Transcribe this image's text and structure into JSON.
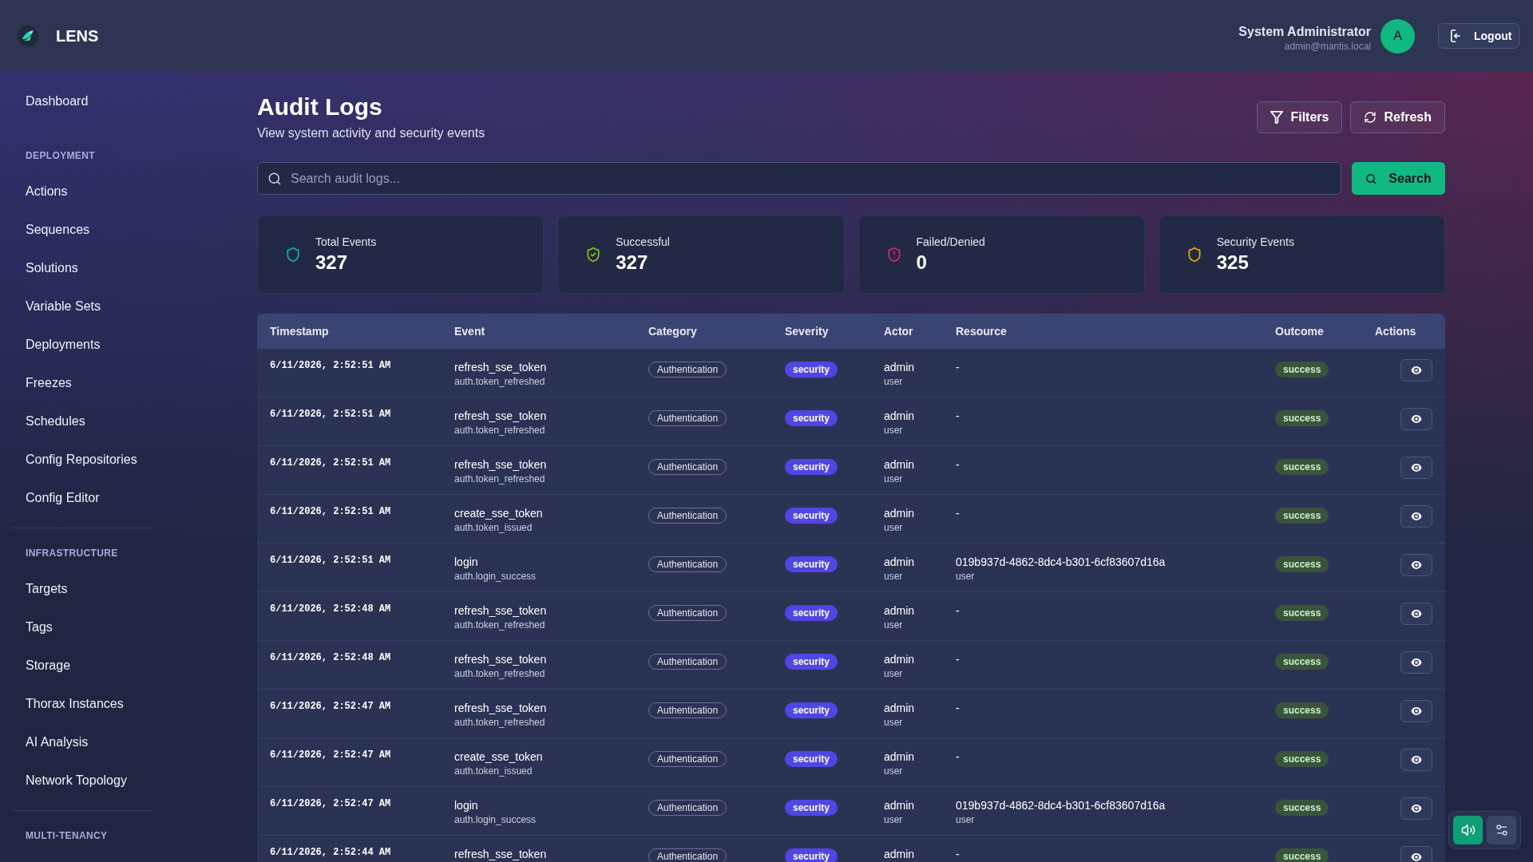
{
  "header": {
    "brand": "LENS",
    "user_name": "System Administrator",
    "user_email": "admin@mantis.local",
    "avatar_initial": "A",
    "logout_label": "Logout"
  },
  "sidebar": {
    "items": [
      {
        "label": "Dashboard",
        "selected": false
      }
    ],
    "sections": [
      {
        "title": "DEPLOYMENT",
        "items": [
          {
            "label": "Actions",
            "selected": false
          },
          {
            "label": "Sequences",
            "selected": false
          },
          {
            "label": "Solutions",
            "selected": false
          },
          {
            "label": "Variable Sets",
            "selected": false
          },
          {
            "label": "Deployments",
            "selected": false
          },
          {
            "label": "Freezes",
            "selected": false
          },
          {
            "label": "Schedules",
            "selected": false
          },
          {
            "label": "Config Repositories",
            "selected": false
          },
          {
            "label": "Config Editor",
            "selected": false
          }
        ]
      },
      {
        "title": "INFRASTRUCTURE",
        "items": [
          {
            "label": "Targets",
            "selected": false
          },
          {
            "label": "Tags",
            "selected": false
          },
          {
            "label": "Storage",
            "selected": false
          },
          {
            "label": "Thorax Instances",
            "selected": false
          },
          {
            "label": "AI Analysis",
            "selected": false
          },
          {
            "label": "Network Topology",
            "selected": false
          }
        ]
      },
      {
        "title": "MULTI-TENANCY"
      }
    ]
  },
  "page": {
    "title": "Audit Logs",
    "subtitle": "View system activity and security events",
    "actions": [
      {
        "label": "Filters"
      },
      {
        "label": "Refresh"
      }
    ]
  },
  "search": {
    "placeholder": "Search audit logs...",
    "button_label": "Search"
  },
  "stats": [
    {
      "label": "Total Events",
      "value": "327",
      "color": "#14b8a6"
    },
    {
      "label": "Successful",
      "value": "327",
      "color": "#84cc16"
    },
    {
      "label": "Failed/Denied",
      "value": "0",
      "color": "#db2777"
    },
    {
      "label": "Security Events",
      "value": "325",
      "color": "#eab308"
    }
  ],
  "table": {
    "columns": [
      "Timestamp",
      "Event",
      "Category",
      "Severity",
      "Actor",
      "Resource",
      "Outcome",
      "Actions"
    ],
    "rows": [
      {
        "timestamp": "6/11/2026, 2:52:51 AM",
        "event": "refresh_sse_token",
        "event_code": "auth.token_refreshed",
        "category": "Authentication",
        "severity": "security",
        "actor": "admin",
        "actor_type": "user",
        "resource": "-",
        "outcome": "success"
      },
      {
        "timestamp": "6/11/2026, 2:52:51 AM",
        "event": "refresh_sse_token",
        "event_code": "auth.token_refreshed",
        "category": "Authentication",
        "severity": "security",
        "actor": "admin",
        "actor_type": "user",
        "resource": "-",
        "outcome": "success"
      },
      {
        "timestamp": "6/11/2026, 2:52:51 AM",
        "event": "refresh_sse_token",
        "event_code": "auth.token_refreshed",
        "category": "Authentication",
        "severity": "security",
        "actor": "admin",
        "actor_type": "user",
        "resource": "-",
        "outcome": "success"
      },
      {
        "timestamp": "6/11/2026, 2:52:51 AM",
        "event": "create_sse_token",
        "event_code": "auth.token_issued",
        "category": "Authentication",
        "severity": "security",
        "actor": "admin",
        "actor_type": "user",
        "resource": "-",
        "outcome": "success"
      },
      {
        "timestamp": "6/11/2026, 2:52:51 AM",
        "event": "login",
        "event_code": "auth.login_success",
        "category": "Authentication",
        "severity": "security",
        "actor": "admin",
        "actor_type": "user",
        "resource": "019b937d-4862-8dc4-b301-6cf83607d16a",
        "resource_type": "user",
        "outcome": "success"
      },
      {
        "timestamp": "6/11/2026, 2:52:48 AM",
        "event": "refresh_sse_token",
        "event_code": "auth.token_refreshed",
        "category": "Authentication",
        "severity": "security",
        "actor": "admin",
        "actor_type": "user",
        "resource": "-",
        "outcome": "success"
      },
      {
        "timestamp": "6/11/2026, 2:52:48 AM",
        "event": "refresh_sse_token",
        "event_code": "auth.token_refreshed",
        "category": "Authentication",
        "severity": "security",
        "actor": "admin",
        "actor_type": "user",
        "resource": "-",
        "outcome": "success"
      },
      {
        "timestamp": "6/11/2026, 2:52:47 AM",
        "event": "refresh_sse_token",
        "event_code": "auth.token_refreshed",
        "category": "Authentication",
        "severity": "security",
        "actor": "admin",
        "actor_type": "user",
        "resource": "-",
        "outcome": "success"
      },
      {
        "timestamp": "6/11/2026, 2:52:47 AM",
        "event": "create_sse_token",
        "event_code": "auth.token_issued",
        "category": "Authentication",
        "severity": "security",
        "actor": "admin",
        "actor_type": "user",
        "resource": "-",
        "outcome": "success"
      },
      {
        "timestamp": "6/11/2026, 2:52:47 AM",
        "event": "login",
        "event_code": "auth.login_success",
        "category": "Authentication",
        "severity": "security",
        "actor": "admin",
        "actor_type": "user",
        "resource": "019b937d-4862-8dc4-b301-6cf83607d16a",
        "resource_type": "user",
        "outcome": "success"
      },
      {
        "timestamp": "6/11/2026, 2:52:44 AM",
        "event": "refresh_sse_token",
        "category": "Authentication",
        "severity": "security",
        "actor": "admin",
        "resource": "-",
        "outcome": "success"
      }
    ]
  },
  "sound_toggle": {
    "on": true
  }
}
